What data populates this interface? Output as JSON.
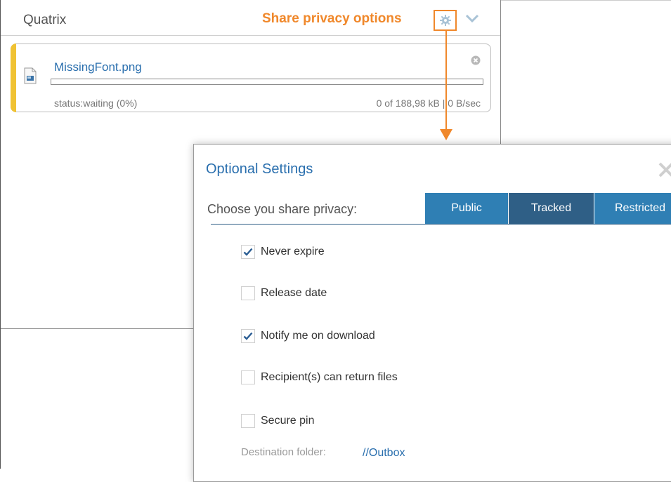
{
  "widget": {
    "title": "Quatrix",
    "annotation": "Share privacy options",
    "file": {
      "name": "MissingFont.png",
      "status": "status:waiting (0%)",
      "size": "0 of 188,98 kB | 0 B/sec",
      "progress_fraction": 0
    }
  },
  "dialog": {
    "title": "Optional Settings",
    "privacy_label": "Choose you share privacy:",
    "tabs": [
      {
        "label": "Public"
      },
      {
        "label": "Tracked",
        "selected": true
      },
      {
        "label": "Restricted"
      }
    ],
    "options": [
      {
        "label": "Never expire",
        "checked": true
      },
      {
        "label": "Release date",
        "checked": false
      },
      {
        "label": "Notify me on download",
        "checked": true
      },
      {
        "label": "Recipient(s) can return files",
        "checked": false
      },
      {
        "label": "Secure pin",
        "checked": false
      }
    ],
    "destination_label": "Destination folder:",
    "destination_value": "//Outbox"
  },
  "colors": {
    "accent_orange": "#f0882b",
    "tab_blue": "#2f7fb4",
    "tab_selected": "#2f5f86",
    "link_blue": "#2a6fae",
    "file_accent": "#f0c233"
  }
}
